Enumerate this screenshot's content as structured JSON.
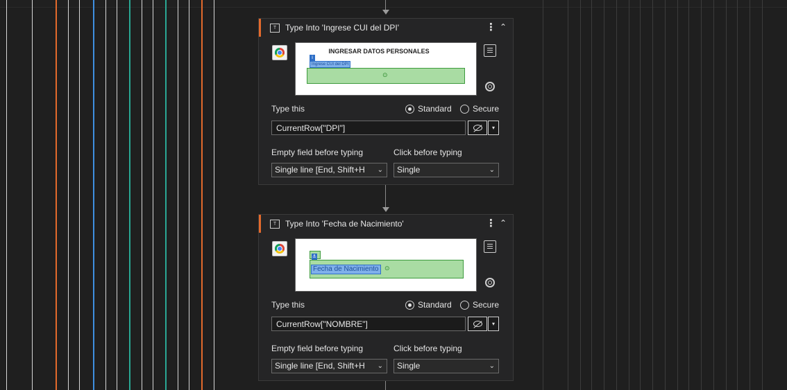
{
  "activities": [
    {
      "title": "Type Into 'Ingrese CUI del DPI'",
      "preview": {
        "page_title": "INGRESAR DATOS PERSONALES",
        "anchor_label": "Ingrese CUI del DPI",
        "anchor_marker": "i"
      },
      "type_this_label": "Type this",
      "mode_standard": "Standard",
      "mode_secure": "Secure",
      "selected_mode": "Standard",
      "value": "CurrentRow[\"DPI\"]",
      "empty_field_label": "Empty field before typing",
      "empty_field_value": "Single line [End, Shift+H",
      "click_before_label": "Click before typing",
      "click_before_value": "Single"
    },
    {
      "title": "Type Into 'Fecha de Nacimiento'",
      "preview": {
        "page_title": "",
        "anchor_label": "Fecha de Nacimiento",
        "anchor_marker": "⚓"
      },
      "type_this_label": "Type this",
      "mode_standard": "Standard",
      "mode_secure": "Secure",
      "selected_mode": "Standard",
      "value": "CurrentRow[\"NOMBRE\"]",
      "empty_field_label": "Empty field before typing",
      "empty_field_value": "Single line [End, Shift+H",
      "click_before_label": "Click before typing",
      "click_before_value": "Single"
    }
  ],
  "icons": {
    "activity": "type-into-icon",
    "browser": "chrome-icon",
    "menu": "vertical-ellipsis-icon",
    "collapse": "chevron-up-icon",
    "options": "hamburger-icon",
    "indicate": "target-icon",
    "mask": "eye-slash-icon",
    "dropdown": "chevron-down-icon"
  },
  "colors": {
    "accent": "#e46a2c",
    "selection": "#a9dca3",
    "anchor": "#7fb0ea"
  },
  "glyphs": {
    "kebab": "⋮",
    "collapse": "⌃",
    "dropdown": "▾",
    "chevron": "⌄",
    "target": "⊙"
  }
}
